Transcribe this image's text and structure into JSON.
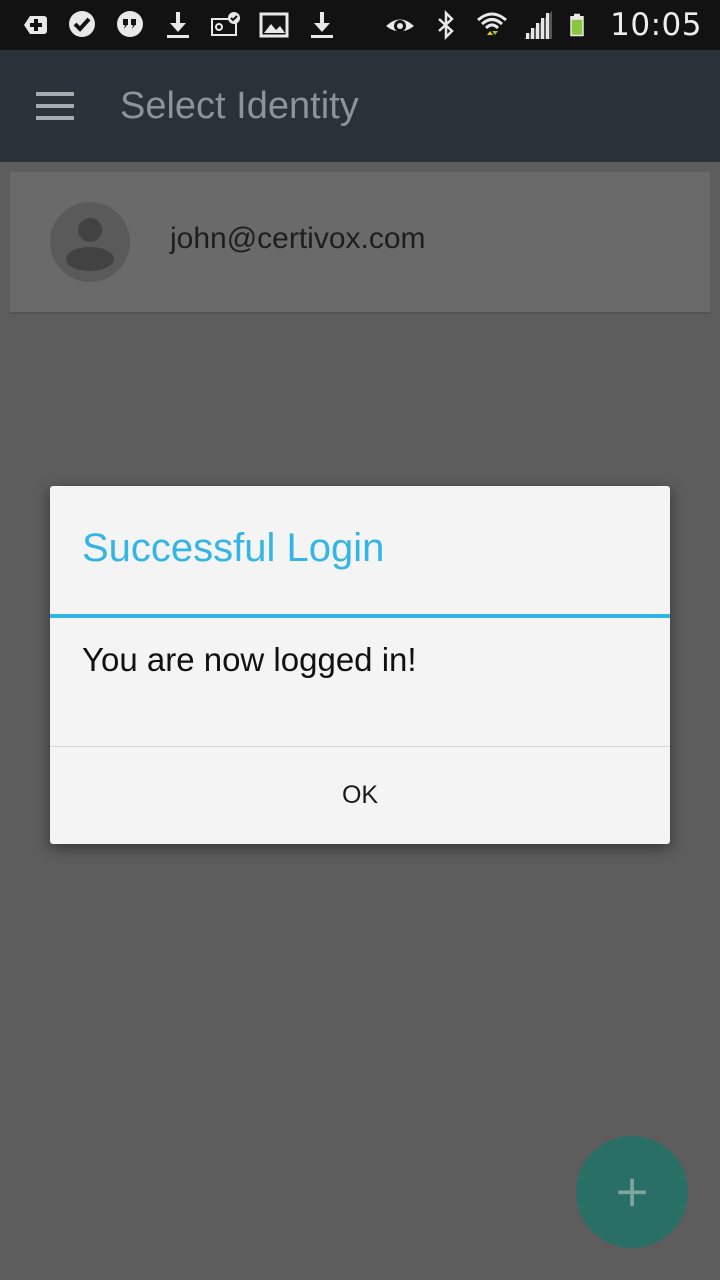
{
  "status_bar": {
    "time": "10:05",
    "left_icons": [
      "plus-app-icon",
      "check-chat-icon",
      "quote-chat-icon",
      "download-icon",
      "voicemail-icon",
      "image-icon",
      "download-icon"
    ],
    "right_icons": [
      "eye-icon",
      "bluetooth-icon",
      "wifi-icon",
      "signal-icon",
      "battery-icon"
    ]
  },
  "app_bar": {
    "title": "Select Identity",
    "menu_icon": "hamburger-menu-icon"
  },
  "identities": [
    {
      "email": "john@certivox.com",
      "avatar": "person-avatar-icon"
    }
  ],
  "dialog": {
    "title": "Successful Login",
    "message": "You are now logged in!",
    "ok_label": "OK"
  },
  "fab": {
    "symbol": "+",
    "icon": "add-icon"
  },
  "colors": {
    "accent": "#33b5e5",
    "app_bar": "#283238",
    "fab": "#2a6f65",
    "battery": "#8cc63f"
  }
}
